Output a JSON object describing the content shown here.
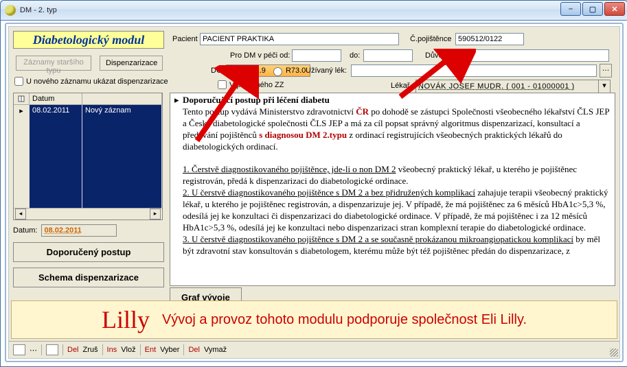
{
  "window": {
    "title": "DM - 2. typ"
  },
  "module_title": "Diabetologický modul",
  "top": {
    "btn_old_records": "Záznamy staršího typu",
    "btn_disp": "Dispenzarizace",
    "chk_new_record": "U nového záznamu ukázat dispenzarizace",
    "pacient_lbl": "Pacient",
    "pacient_val": "PACIENT PRAKTIKA",
    "cpoj_lbl": "Č.pojištěnce",
    "cpoj_val": "590512/0122",
    "pece_od_lbl": "Pro DM v péči od:",
    "pece_od_val": "",
    "do_lbl": "do:",
    "do_val": "",
    "duvod_lbl": "Důvod:",
    "duvod_val": "",
    "dg_lbl": "DG",
    "dg_opt1": "E11.9",
    "dg_opt2": "R73.0",
    "lek_lbl": "Užívaný lék:",
    "lek_val": "",
    "jinezz_lbl": "V péči jiného ZZ",
    "lekar_lbl": "Lékař",
    "lekar_val": "NOVÁK JOSEF MUDR. ( 001 - 01000001 )"
  },
  "grid": {
    "col_date": "Datum",
    "row_date": "08.02.2011",
    "row_text": "Nový záznam"
  },
  "datum_lbl": "Datum:",
  "datum_val": "08.02.2011",
  "btn_recommended": "Doporučený postup",
  "btn_schema": "Schema dispenzarizace",
  "btn_graph": "Graf vývoje",
  "content": {
    "title": "Doporučující postup při léčení diabetu",
    "p0a": "Tento postup vydává Ministerstvo zdravotnictví ",
    "p0_cr": "ČR",
    "p0b": " po dohodě se zástupci Společnosti všeobecného lékařství ČLS JEP a České diabetologické společnosti ČLS JEP a má za cíl popsat správný algoritmus dispenzarizací, konsultací a předávání pojištěnců ",
    "p0_dm2": "s diagnosou  DM 2.typu",
    "p0c": " z ordinací registrujících všeobecných praktických lékařů do diabetologických ordinací.",
    "p1_u": "1. Čerstvě diagnostikovaného pojištěnce, jde-li o non DM 2",
    "p1_t": "  všeobecný praktický lékař, u kterého je pojištěnec registrován,  předá k dispenzarizaci do diabetologické ordinace.",
    "p2_u": "2. U čerstvě diagnostikovaného pojištěnce s DM 2 a bez přidružených komplikací",
    "p2_t": " zahajuje terapii všeobecný praktický lékař, u kterého je pojištěnec registrován, a dispenzarizuje jej. V případě, že má pojištěnec za 6 měsíců HbA1c>5,3 %, odesílá jej ke konzultaci či dispenzarizaci do diabetologické ordinace. V případě, že má pojištěnec i za 12 měsíců HbA1c>5,3 %, odesílá jej ke konzultaci nebo dispenzarizaci stran komplexní terapie do diabetologické ordinace.",
    "p3_u": "3. U čerstvě diagnostikovaného pojištěnce s DM 2 a se současně prokázanou mikroangiopatickou komplikací",
    "p3_t": " by měl být zdravotní stav konsultován s diabetologem, kterému může být též pojištěnec předán do dispenzarizace, z"
  },
  "banner": {
    "logo": "Lilly",
    "text": "Vývoj a provoz tohoto modulu podporuje společnost Eli Lilly."
  },
  "status": {
    "del1": "Del",
    "zrus": "Zruš",
    "ins": "Ins",
    "vloz": "Vlož",
    "ent": "Ent",
    "vyber": "Vyber",
    "del2": "Del",
    "vymaz": "Vymaž"
  }
}
